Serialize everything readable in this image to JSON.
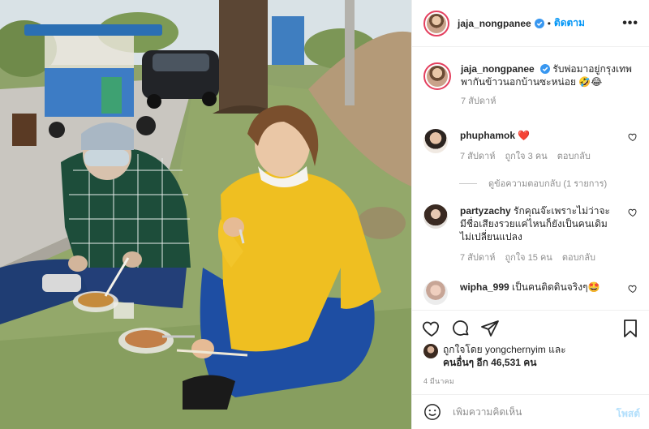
{
  "header": {
    "username": "jaja_nongpanee",
    "separator": "•",
    "follow_label": "ติดตาม",
    "more_label": "•••"
  },
  "caption": {
    "username": "jaja_nongpanee",
    "text": "รับพ่อมาอยู่กรุงเทพ พากันข้าวนอกบ้านซะหน่อย 🤣😂",
    "time": "7 สัปดาห์"
  },
  "comments": [
    {
      "username": "phuphamok",
      "text": "❤️",
      "time": "7 สัปดาห์",
      "likes": "ถูกใจ 3 คน",
      "reply_label": "ตอบกลับ",
      "avatar_color": "#caa58c"
    },
    {
      "username": "partyzachy",
      "text": "รักคุณจ๊ะเพราะไม่ว่าจะมีชื่อเสียงรวยแค่ไหนก็ยังเป็นคนเดิมไม่เปลี่ยนแปลง",
      "time": "7 สัปดาห์",
      "likes": "ถูกใจ 15 คน",
      "reply_label": "ตอบกลับ",
      "avatar_color": "#3a2a22"
    },
    {
      "username": "wipha_999",
      "text": "เป็นคนติดดินจริงๆ🤩",
      "time": "",
      "likes": "",
      "reply_label": "",
      "avatar_color": "#d9b8a6"
    }
  ],
  "view_replies": "ดูข้อความตอบกลับ (1 รายการ)",
  "actions": {
    "liked_by_prefix": "ถูกใจโดย",
    "liked_by_user": "yongchernyim",
    "liked_by_and": "และ",
    "others_label": "คนอื่นๆ อีก 46,531 คน",
    "date": "4 มีนาคม"
  },
  "add_comment": {
    "placeholder": "เพิ่มความคิดเห็น",
    "post_label": "โพสต์"
  },
  "colors": {
    "accent": "#0095f6",
    "verified": "#3897f0",
    "heart_red": "#ed4956",
    "muted": "#8e8e8e",
    "post_disabled": "#b2dffc"
  },
  "icons": [
    "verified-badge-icon",
    "more-options-icon",
    "heart-icon",
    "comment-icon",
    "share-icon",
    "bookmark-icon",
    "emoji-icon"
  ]
}
